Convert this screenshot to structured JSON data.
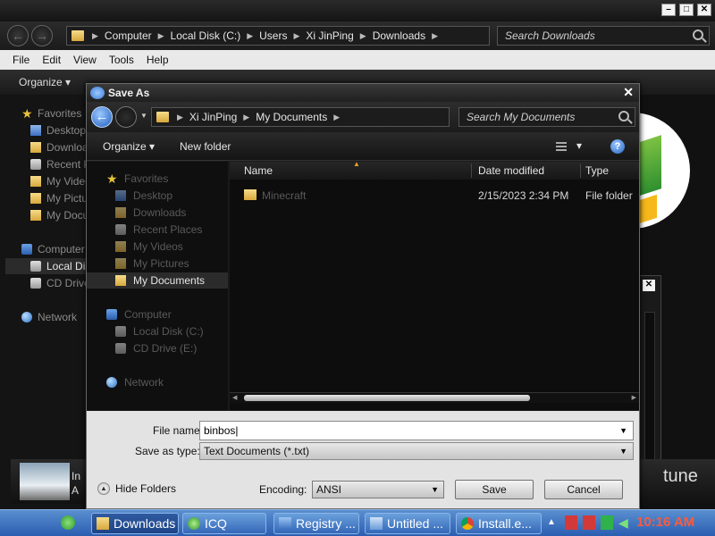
{
  "explorer": {
    "breadcrumb": [
      "Computer",
      "Local Disk (C:)",
      "Users",
      "Xi JinPing",
      "Downloads"
    ],
    "search_placeholder": "Search Downloads",
    "menu": [
      "File",
      "Edit",
      "View",
      "Tools",
      "Help"
    ],
    "organize_label": "Organize",
    "sidebar_items": [
      "Favorites",
      "Desktop",
      "Downloads",
      "Recent Places",
      "My Videos",
      "My Pictures",
      "My Documents",
      "Computer",
      "Local Disk (C:)",
      "CD Drive (E:)",
      "Network"
    ],
    "media_line1": "In",
    "media_line2": "A",
    "media_brand": "tune"
  },
  "dialog": {
    "title": "Save As",
    "close_glyph": "✕",
    "breadcrumb": [
      "Xi JinPing",
      "My Documents"
    ],
    "search_placeholder": "Search My Documents",
    "organize_label": "Organize",
    "new_folder_label": "New folder",
    "nav_items": [
      {
        "label": "Favorites",
        "icon": "star-icon"
      },
      {
        "label": "Desktop",
        "icon": "desktop-icon"
      },
      {
        "label": "Downloads",
        "icon": "folder-icon"
      },
      {
        "label": "Recent Places",
        "icon": "recent-places-icon"
      },
      {
        "label": "My Videos",
        "icon": "folder-icon"
      },
      {
        "label": "My Pictures",
        "icon": "folder-icon"
      },
      {
        "label": "My Documents",
        "icon": "folder-icon"
      },
      {
        "label": "Computer",
        "icon": "computer-icon"
      },
      {
        "label": "Local Disk (C:)",
        "icon": "drive-icon"
      },
      {
        "label": "CD Drive (E:)",
        "icon": "cd-drive-icon"
      },
      {
        "label": "Network",
        "icon": "network-icon"
      }
    ],
    "selected_nav": "My Documents",
    "columns": {
      "name": "Name",
      "date": "Date modified",
      "type": "Type"
    },
    "files": [
      {
        "name": "Minecraft",
        "date": "2/15/2023 2:34 PM",
        "type": "File folder"
      }
    ],
    "file_name_label": "File name:",
    "file_name_value": "binbos",
    "save_type_label": "Save as type:",
    "save_type_value": "Text Documents (*.txt)",
    "hide_folders_label": "Hide Folders",
    "encoding_label": "Encoding:",
    "encoding_value": "ANSI",
    "save_button": "Save",
    "cancel_button": "Cancel"
  },
  "taskbar": {
    "items": [
      {
        "label": "Downloads",
        "icon": "folder-icon"
      },
      {
        "label": "ICQ",
        "icon": "icq-icon"
      },
      {
        "label": "Registry ...",
        "icon": "registry-icon"
      },
      {
        "label": "Untitled ...",
        "icon": "notepad-icon"
      },
      {
        "label": "Install.e...",
        "icon": "chrome-icon"
      }
    ],
    "clock": "10:16 AM"
  },
  "colors": {
    "clock": "#ff5a3a",
    "taskbar": "#3468b8",
    "accent_blue": "#2764c0"
  }
}
